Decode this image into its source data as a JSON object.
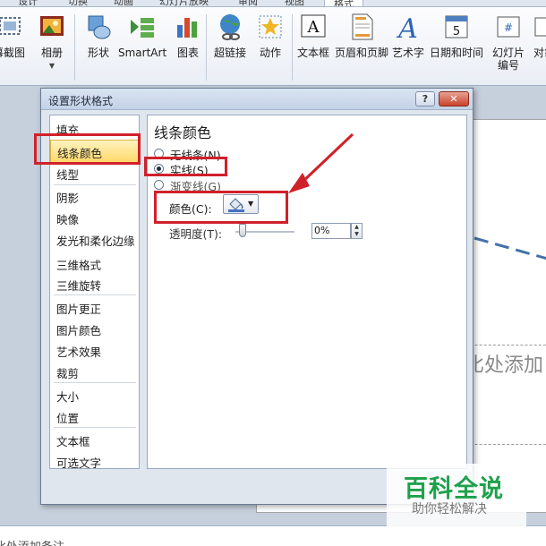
{
  "ribbon": {
    "tabs": [
      "设计",
      "切换",
      "动画",
      "幻灯片放映",
      "审阅",
      "视图",
      "格式"
    ],
    "buttons": [
      {
        "label": "幕截图",
        "icon": "screenshot-icon"
      },
      {
        "label": "相册",
        "icon": "photo-album-icon"
      },
      {
        "label": "形状",
        "icon": "shapes-icon"
      },
      {
        "label": "SmartArt",
        "icon": "smartart-icon"
      },
      {
        "label": "图表",
        "icon": "chart-icon"
      },
      {
        "label": "超链接",
        "icon": "hyperlink-icon"
      },
      {
        "label": "动作",
        "icon": "action-icon"
      },
      {
        "label": "文本框",
        "icon": "textbox-icon"
      },
      {
        "label": "页眉和页脚",
        "icon": "header-footer-icon"
      },
      {
        "label": "艺术字",
        "icon": "wordart-icon"
      },
      {
        "label": "日期和时间",
        "icon": "date-time-icon"
      },
      {
        "label": "幻灯片编号",
        "icon": "slide-number-icon"
      },
      {
        "label": "对象",
        "icon": "object-icon"
      }
    ]
  },
  "slide": {
    "placeholder_text": "比处添加",
    "notes_text": "比处添加备注",
    "line_color": "#4472a8"
  },
  "dialog": {
    "title": "设置形状格式",
    "help_label": "?",
    "close_label": "✕",
    "nav": [
      "填充",
      "线条颜色",
      "线型",
      "阴影",
      "映像",
      "发光和柔化边缘",
      "三维格式",
      "三维旋转",
      "图片更正",
      "图片颜色",
      "艺术效果",
      "裁剪",
      "大小",
      "位置",
      "文本框",
      "可选文字"
    ],
    "selected_nav": "线条颜色",
    "section_title": "线条颜色",
    "options": [
      {
        "label": "无线条(N)",
        "selected": false
      },
      {
        "label": "实线(S)",
        "selected": true
      },
      {
        "label": "渐变线(G)",
        "selected": false
      }
    ],
    "color_label": "颜色(C):",
    "transparency_label": "透明度(T):",
    "transparency_value": "0%",
    "transparency_fraction": 0
  },
  "watermark": {
    "title": "百科全说",
    "subtitle": "助你轻松解决"
  },
  "colors": {
    "highlight": "#d0212a",
    "selected_bg": "#ffd86a",
    "watermark_green": "#1fa14b"
  }
}
